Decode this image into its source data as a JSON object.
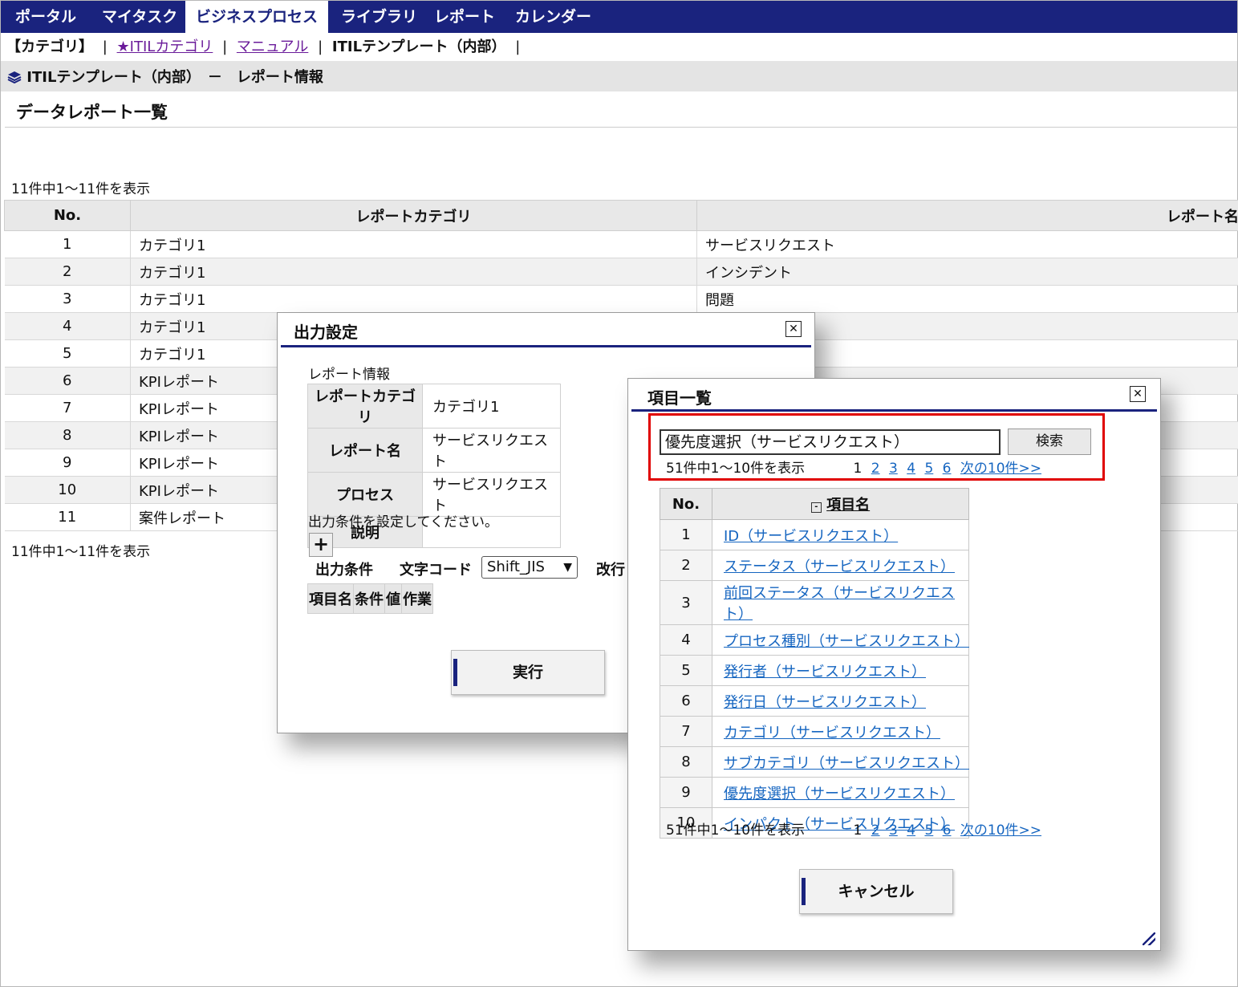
{
  "nav": {
    "tabs": [
      "ポータル",
      "マイタスク",
      "ビジネスプロセス",
      "ライブラリ",
      "レポート",
      "カレンダー"
    ],
    "active_tab": "ビジネスプロセス"
  },
  "subnav": {
    "category": "【カテゴリ】",
    "sep": "|",
    "itil_category": "★ITILカテゴリ",
    "manual": "マニュアル",
    "template": "ITILテンプレート（内部）"
  },
  "breadcrumb": "ITILテンプレート（内部）　－　レポート情報",
  "page_title": "データレポート一覧",
  "list": {
    "count_top": "11件中1～11件を表示",
    "count_bottom": "11件中1～11件を表示",
    "headers": {
      "no": "No.",
      "category": "レポートカテゴリ",
      "name": "レポート名"
    },
    "rows": [
      {
        "no": "1",
        "category": "カテゴリ1",
        "name": "サービスリクエスト"
      },
      {
        "no": "2",
        "category": "カテゴリ1",
        "name": "インシデント"
      },
      {
        "no": "3",
        "category": "カテゴリ1",
        "name": "問題"
      },
      {
        "no": "4",
        "category": "カテゴリ1",
        "name": ""
      },
      {
        "no": "5",
        "category": "カテゴリ1",
        "name": ""
      },
      {
        "no": "6",
        "category": "KPIレポート",
        "name": ""
      },
      {
        "no": "7",
        "category": "KPIレポート",
        "name": ""
      },
      {
        "no": "8",
        "category": "KPIレポート",
        "name": ""
      },
      {
        "no": "9",
        "category": "KPIレポート",
        "name": ""
      },
      {
        "no": "10",
        "category": "KPIレポート",
        "name": ""
      },
      {
        "no": "11",
        "category": "案件レポート",
        "name": ""
      }
    ]
  },
  "output_dialog": {
    "title": "出力設定",
    "section_label": "レポート情報",
    "info": [
      {
        "key": "レポートカテゴリ",
        "value": "カテゴリ1"
      },
      {
        "key": "レポート名",
        "value": "サービスリクエスト"
      },
      {
        "key": "プロセス",
        "value": "サービスリクエスト"
      },
      {
        "key": "説明",
        "value": ""
      }
    ],
    "condition_hint": "出力条件を設定してください。",
    "add_icon": "plus-icon",
    "output_condition_label": "出力条件",
    "charset_label": "文字コード",
    "charset_value": "Shift_JIS",
    "newline_label": "改行",
    "cond_headers": [
      "項目名",
      "条件",
      "値",
      "作業"
    ],
    "run_button": "実行"
  },
  "items_dialog": {
    "title": "項目一覧",
    "search_value": "優先度選択（サービスリクエスト）",
    "search_button": "検索",
    "count": "51件中1～10件を表示",
    "current_page": "1",
    "pages": [
      "2",
      "3",
      "4",
      "5",
      "6"
    ],
    "next_label": "次の10件>>",
    "headers": {
      "no": "No.",
      "name": "項目名"
    },
    "items": [
      {
        "no": "1",
        "name": "ID（サービスリクエスト）"
      },
      {
        "no": "2",
        "name": "ステータス（サービスリクエスト）"
      },
      {
        "no": "3",
        "name": "前回ステータス（サービスリクエスト）"
      },
      {
        "no": "4",
        "name": "プロセス種別（サービスリクエスト）"
      },
      {
        "no": "5",
        "name": "発行者（サービスリクエスト）"
      },
      {
        "no": "6",
        "name": "発行日（サービスリクエスト）"
      },
      {
        "no": "7",
        "name": "カテゴリ（サービスリクエスト）"
      },
      {
        "no": "8",
        "name": "サブカテゴリ（サービスリクエスト）"
      },
      {
        "no": "9",
        "name": "優先度選択（サービスリクエスト）"
      },
      {
        "no": "10",
        "name": "インパクト（サービスリクエスト）"
      }
    ],
    "cancel_button": "キャンセル"
  },
  "colors": {
    "nav": "#1a237e",
    "highlight": "#e00000",
    "link": "#1565c0"
  }
}
